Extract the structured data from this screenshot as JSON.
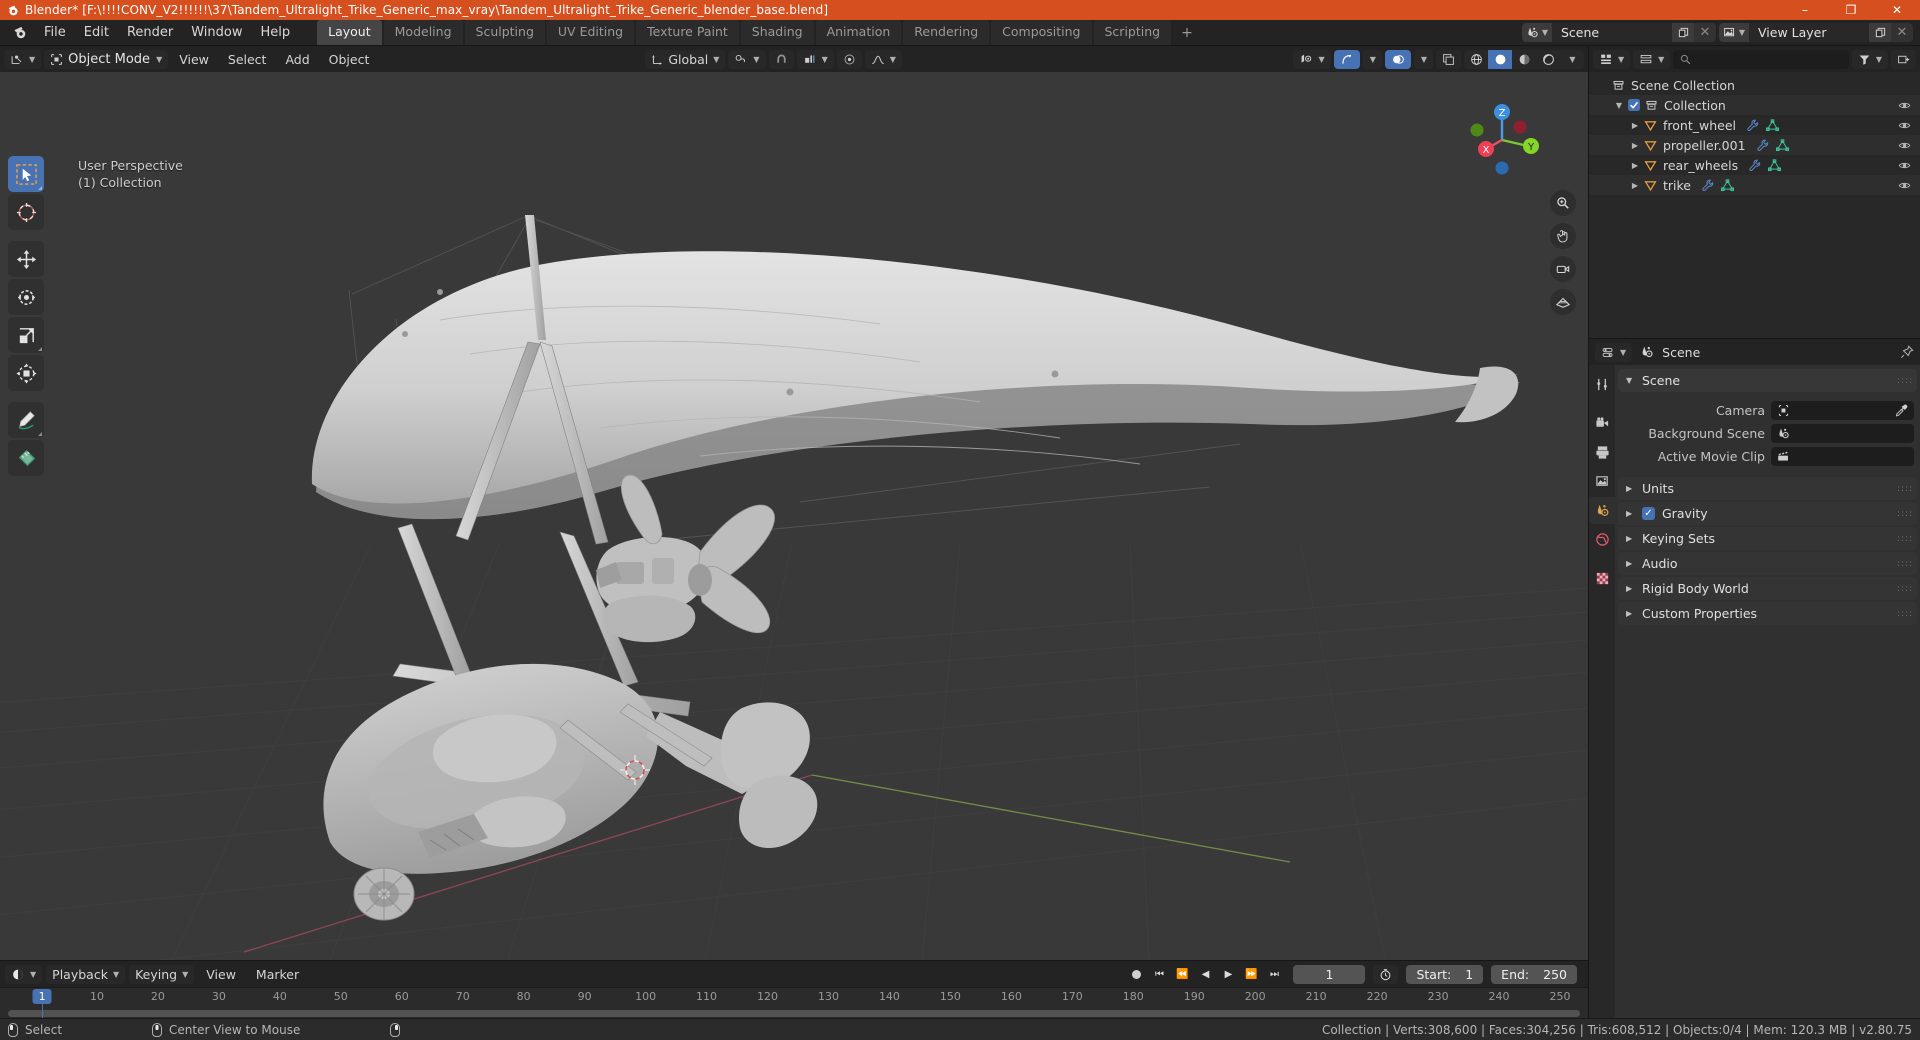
{
  "window": {
    "title": "Blender* [F:\\!!!!CONV_V2!!!!!!\\37\\Tandem_Ultralight_Trike_Generic_max_vray\\Tandem_Ultralight_Trike_Generic_blender_base.blend]",
    "minimize": "–",
    "maximize": "❐",
    "close": "✕"
  },
  "menus": [
    "File",
    "Edit",
    "Render",
    "Window",
    "Help"
  ],
  "workspaces": {
    "tabs": [
      "Layout",
      "Modeling",
      "Sculpting",
      "UV Editing",
      "Texture Paint",
      "Shading",
      "Animation",
      "Rendering",
      "Compositing",
      "Scripting"
    ],
    "active": "Layout",
    "add": "+"
  },
  "topbar_right": {
    "scene": "Scene",
    "view_layer": "View Layer"
  },
  "viewport_header": {
    "mode": "Object Mode",
    "menus": [
      "View",
      "Select",
      "Add",
      "Object"
    ],
    "transform_orientation": "Global"
  },
  "viewport": {
    "perspective": "User Perspective",
    "collection": "(1) Collection",
    "gizmo_axes": [
      "X",
      "Y",
      "Z"
    ],
    "tools": [
      "tweak-select-box-tool",
      "cursor-tool",
      "move-tool",
      "rotate-tool",
      "scale-tool",
      "transform-tool",
      "annotate-tool",
      "measure-tool"
    ]
  },
  "outliner": {
    "search_placeholder": "",
    "rows": [
      {
        "label": "Scene Collection",
        "depth": 0,
        "icon": "collection-icon",
        "disclosure": "",
        "checkbox": false,
        "modifiers": false,
        "eye": false
      },
      {
        "label": "Collection",
        "depth": 1,
        "icon": "collection-icon",
        "disclosure": "▼",
        "checkbox": true,
        "modifiers": false,
        "eye": true
      },
      {
        "label": "front_wheel",
        "depth": 2,
        "icon": "mesh-object-icon",
        "disclosure": "▶",
        "checkbox": false,
        "modifiers": true,
        "eye": true
      },
      {
        "label": "propeller.001",
        "depth": 2,
        "icon": "mesh-object-icon",
        "disclosure": "▶",
        "checkbox": false,
        "modifiers": true,
        "eye": true
      },
      {
        "label": "rear_wheels",
        "depth": 2,
        "icon": "mesh-object-icon",
        "disclosure": "▶",
        "checkbox": false,
        "modifiers": true,
        "eye": true
      },
      {
        "label": "trike",
        "depth": 2,
        "icon": "mesh-object-icon",
        "disclosure": "▶",
        "checkbox": false,
        "modifiers": true,
        "eye": true
      }
    ]
  },
  "properties": {
    "breadcrumb": "Scene",
    "panels": [
      {
        "label": "Scene",
        "open": true
      },
      {
        "label": "Units",
        "open": false
      },
      {
        "label": "Gravity",
        "open": false,
        "checkbox": true
      },
      {
        "label": "Keying Sets",
        "open": false
      },
      {
        "label": "Audio",
        "open": false
      },
      {
        "label": "Rigid Body World",
        "open": false
      },
      {
        "label": "Custom Properties",
        "open": false
      }
    ],
    "fields": [
      {
        "label": "Camera",
        "value": "",
        "icon": "camera-icon",
        "eyedropper": true
      },
      {
        "label": "Background Scene",
        "value": "",
        "icon": "scene-icon",
        "eyedropper": false
      },
      {
        "label": "Active Movie Clip",
        "value": "",
        "icon": "clip-icon",
        "eyedropper": false
      }
    ],
    "tabs": [
      "tool-tab",
      "render-tab",
      "output-tab",
      "view-layer-tab",
      "scene-tab",
      "world-tab",
      "texture-tab"
    ],
    "active_tab": "scene-tab"
  },
  "timeline": {
    "menus": [
      "Playback",
      "Keying",
      "View",
      "Marker"
    ],
    "current_frame": "1",
    "start_label": "Start:",
    "start_value": "1",
    "end_label": "End:",
    "end_value": "250",
    "ticks": [
      10,
      20,
      30,
      40,
      50,
      60,
      70,
      80,
      90,
      100,
      110,
      120,
      130,
      140,
      150,
      160,
      170,
      180,
      190,
      200,
      210,
      220,
      230,
      240,
      250
    ]
  },
  "statusbar": {
    "hints": [
      {
        "mouse": "left-mouse-icon",
        "label": "Select"
      },
      {
        "mouse": "middle-mouse-icon",
        "label": "Center View to Mouse"
      },
      {
        "mouse": "right-mouse-icon",
        "label": ""
      }
    ],
    "stats": "Collection | Verts:308,600 | Faces:304,256 | Tris:608,512 | Objects:0/4 | Mem: 120.3 MB | v2.80.75"
  },
  "colors": {
    "accent": "#4772b3",
    "title_bar": "#d64f1e",
    "viewport_bg": "#393939",
    "mesh": "#b8b8b8"
  }
}
